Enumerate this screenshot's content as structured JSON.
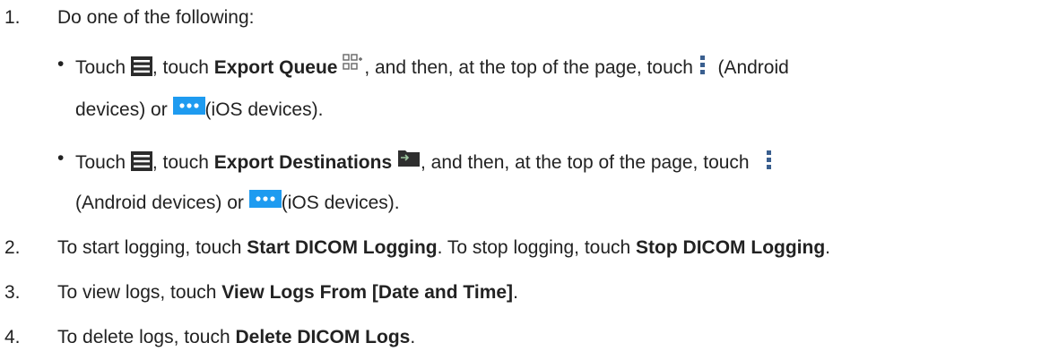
{
  "steps": [
    {
      "num": "1.",
      "text": "Do one of the following:"
    },
    {
      "num": "2.",
      "pre": "To start logging, touch ",
      "b1": "Start DICOM Logging",
      "mid": ". To stop logging, touch ",
      "b2": "Stop DICOM Logging",
      "post": "."
    },
    {
      "num": "3.",
      "pre": "To view logs, touch ",
      "b1": "View Logs From [Date and Time]",
      "post": "."
    },
    {
      "num": "4.",
      "pre": "To delete logs, touch ",
      "b1": "Delete DICOM Logs",
      "post": "."
    }
  ],
  "bullets": [
    {
      "dot": "•",
      "t1": "Touch ",
      "t2": ", touch ",
      "bold": "Export Queue",
      "t3": ", and then, at the top of the page, touch ",
      "t4": "(Android",
      "c1": "devices) or ",
      "c2": "(iOS devices)."
    },
    {
      "dot": "•",
      "t1": "Touch ",
      "t2": ", touch ",
      "bold": "Export Destinations",
      "t3": ", and then, at the top of the page, touch",
      "c1": "(Android devices) or ",
      "c2": "(iOS devices)."
    }
  ],
  "icons": {
    "menu": "hamburger-menu-icon",
    "export_queue": "export-queue-icon",
    "export_destinations": "export-destinations-icon",
    "android_more": "kebab-menu-icon",
    "ios_more": "ios-more-icon"
  },
  "colors": {
    "text": "#222222",
    "menu_icon": "#2b2b2b",
    "kebab": "#3a5f8f",
    "ios_blue": "#1e9bf0"
  }
}
